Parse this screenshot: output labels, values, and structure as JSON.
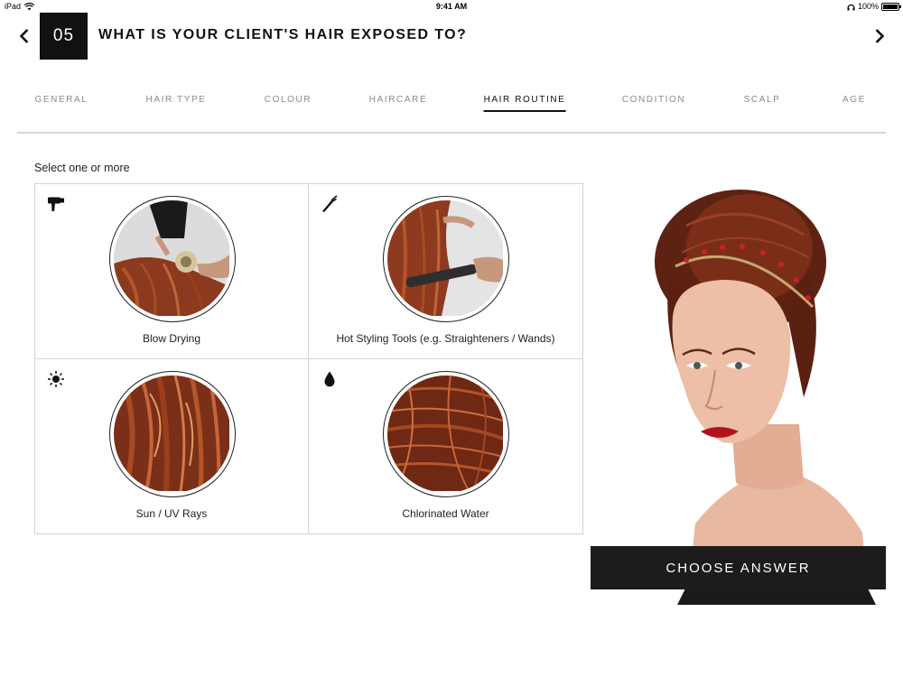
{
  "status_bar": {
    "device": "iPad",
    "time": "9:41 AM",
    "battery": "100%",
    "battery_level": 1.0
  },
  "header": {
    "step_number": "05",
    "question": "WHAT IS YOUR CLIENT'S HAIR EXPOSED TO?",
    "back_icon": "chevron-left-icon",
    "next_icon": "chevron-right-icon"
  },
  "tabs": [
    {
      "label": "GENERAL",
      "active": false
    },
    {
      "label": "HAIR TYPE",
      "active": false
    },
    {
      "label": "COLOUR",
      "active": false
    },
    {
      "label": "HAIRCARE",
      "active": false
    },
    {
      "label": "HAIR ROUTINE",
      "active": true
    },
    {
      "label": "CONDITION",
      "active": false
    },
    {
      "label": "SCALP",
      "active": false
    },
    {
      "label": "AGE",
      "active": false
    }
  ],
  "instruction": "Select one or more",
  "options": [
    {
      "label": "Blow Drying",
      "icon": "hair-dryer-icon"
    },
    {
      "label": "Hot Styling Tools (e.g. Straighteners / Wands)",
      "icon": "straightener-icon"
    },
    {
      "label": "Sun / UV Rays",
      "icon": "sun-icon"
    },
    {
      "label": "Chlorinated Water",
      "icon": "water-drop-icon"
    }
  ],
  "cta": {
    "label": "CHOOSE ANSWER"
  },
  "colors": {
    "accent": "#111111",
    "button_bg": "#1c1c1c",
    "hair": "#8a3a1e",
    "tab_inactive": "#8a8a8a",
    "divider": "#d6d6d6"
  }
}
